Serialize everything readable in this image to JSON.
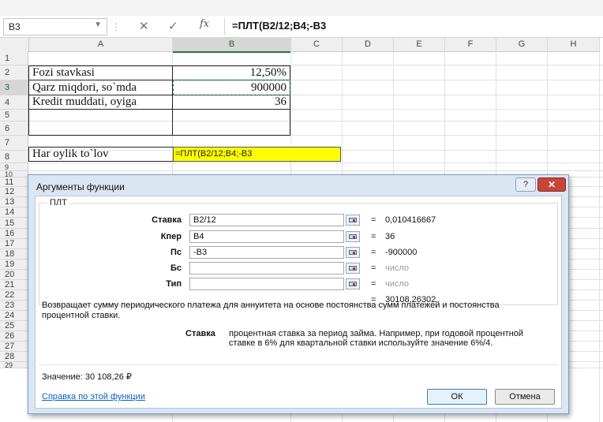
{
  "formula_bar": {
    "name_box": "B3",
    "fx": "fx",
    "formula": "=ПЛТ(B2/12;B4;-B3"
  },
  "columns": [
    "A",
    "B",
    "C",
    "D",
    "E",
    "F",
    "G",
    "H"
  ],
  "rows": [
    "1",
    "2",
    "3",
    "4",
    "5",
    "6",
    "7",
    "8",
    "9",
    "10",
    "11",
    "12",
    "13",
    "14",
    "15",
    "16",
    "17",
    "18",
    "19",
    "20",
    "21",
    "22",
    "23",
    "24",
    "25",
    "26",
    "27",
    "28",
    "29"
  ],
  "cells": {
    "a2": "Fozi stavkasi",
    "b2": "12,50%",
    "a3": "Qarz miqdori, so`mda",
    "b3": "900000",
    "a4": "Kredit muddati, oyiga",
    "b4": "36",
    "a7": "Har oylik to`lov",
    "b7": "=ПЛТ(B2/12;B4;-B3"
  },
  "dialog": {
    "title": "Аргументы функции",
    "help_button": "?",
    "close_button": "✕",
    "function_name": "ПЛТ",
    "args": [
      {
        "label": "Ставка",
        "value": "B2/12",
        "result": "0,010416667"
      },
      {
        "label": "Кпер",
        "value": "B4",
        "result": "36"
      },
      {
        "label": "Пс",
        "value": "-B3",
        "result": "-900000"
      },
      {
        "label": "Бс",
        "value": "",
        "result": "число"
      },
      {
        "label": "Тип",
        "value": "",
        "result": "число"
      }
    ],
    "total_result": "30108,26302",
    "description": "Возвращает сумму периодического платежа для аннуитета на основе постоянства сумм платежей и постоянства процентной ставки.",
    "arg_desc_label": "Ставка",
    "arg_desc": "процентная ставка за период займа. Например, при годовой процентной ставке в 6% для квартальной ставки используйте значение 6%/4.",
    "value_label": "Значение:  30 108,26 ₽",
    "help_link": "Справка по этой функции",
    "ok_label": "ОК",
    "cancel_label": "Отмена"
  },
  "colors": {
    "accent_green": "#217346",
    "highlight_yellow": "#ffff00",
    "dialog_frame": "#dbe6f3",
    "close_red": "#c7453a",
    "link_blue": "#0b5fc1"
  }
}
